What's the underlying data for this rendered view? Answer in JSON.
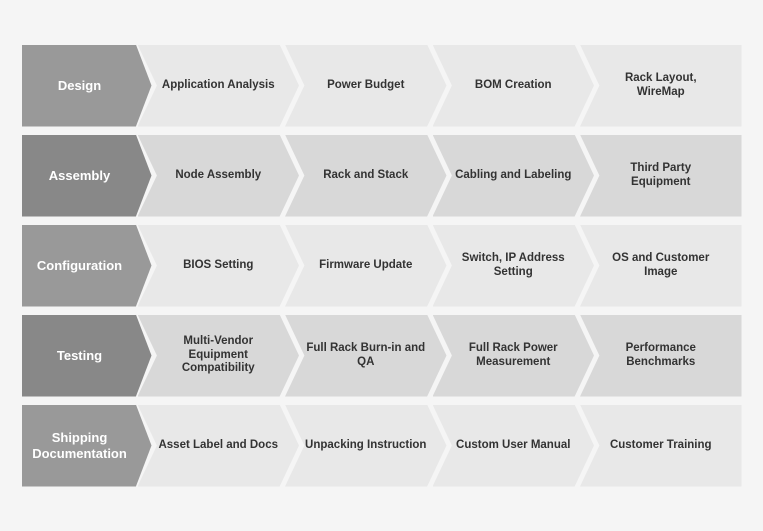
{
  "diagram": {
    "rows": [
      {
        "label": "Design",
        "steps": [
          "Application Analysis",
          "Power Budget",
          "BOM Creation",
          "Rack Layout, WireMap"
        ]
      },
      {
        "label": "Assembly",
        "steps": [
          "Node Assembly",
          "Rack and Stack",
          "Cabling and Labeling",
          "Third Party Equipment"
        ]
      },
      {
        "label": "Configuration",
        "steps": [
          "BIOS Setting",
          "Firmware Update",
          "Switch, IP Address Setting",
          "OS and Customer Image"
        ]
      },
      {
        "label": "Testing",
        "steps": [
          "Multi-Vendor Equipment Compatibility",
          "Full Rack Burn-in and QA",
          "Full Rack Power Measurement",
          "Performance Benchmarks"
        ]
      },
      {
        "label": "Shipping Documentation",
        "steps": [
          "Asset Label and Docs",
          "Unpacking Instruction",
          "Custom User Manual",
          "Customer Training"
        ]
      }
    ]
  }
}
